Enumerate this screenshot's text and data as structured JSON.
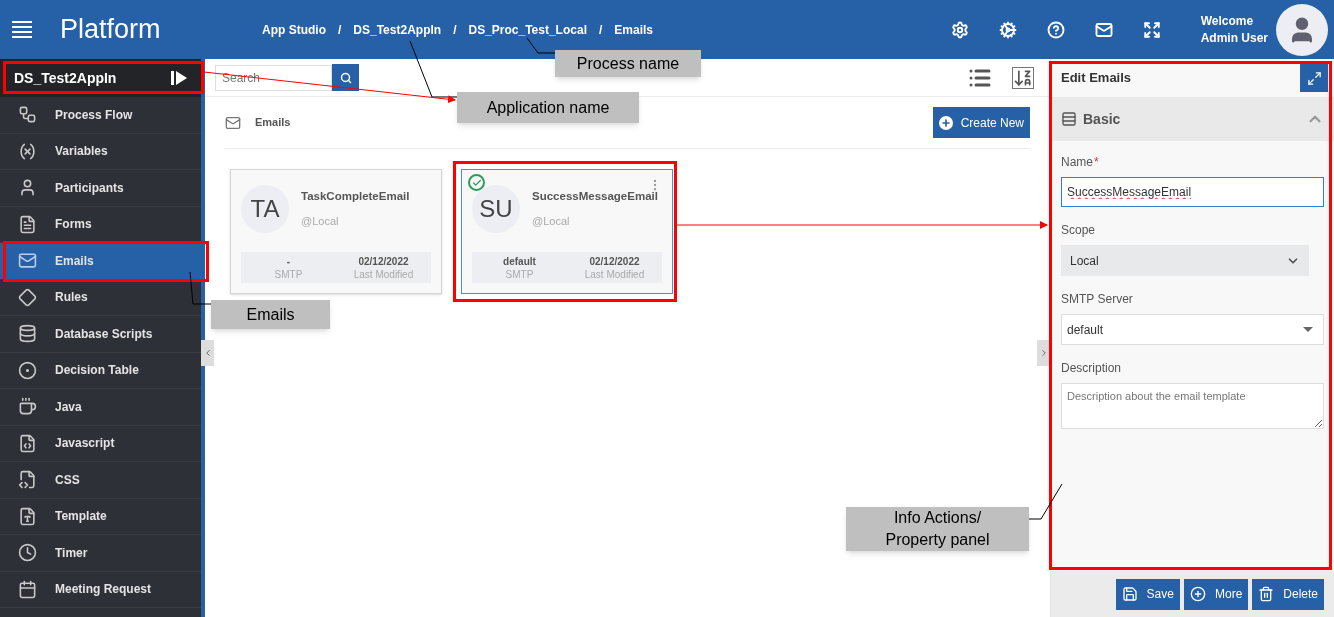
{
  "header": {
    "title": "Platform",
    "breadcrumbs": [
      {
        "label": "App Studio"
      },
      {
        "separator": "/",
        "label": "DS_Test2AppIn"
      },
      {
        "separator": "/",
        "label": "DS_Proc_Test_Local"
      },
      {
        "separator": "/",
        "label": "Emails"
      }
    ],
    "welcome": "Welcome",
    "user": "Admin User"
  },
  "sidebar": {
    "app_name": "DS_Test2AppIn",
    "items": [
      {
        "label": "Process Flow",
        "kind": "flow",
        "selected": false
      },
      {
        "label": "Variables",
        "kind": "variable",
        "selected": false
      },
      {
        "label": "Participants",
        "kind": "user",
        "selected": false
      },
      {
        "label": "Forms",
        "kind": "form",
        "selected": false
      },
      {
        "label": "Emails",
        "kind": "mail",
        "selected": true
      },
      {
        "label": "Rules",
        "kind": "rule",
        "selected": false
      },
      {
        "label": "Database Scripts",
        "kind": "database",
        "selected": false
      },
      {
        "label": "Decision Table",
        "kind": "table",
        "selected": false
      },
      {
        "label": "Java",
        "kind": "java",
        "selected": false
      },
      {
        "label": "Javascript",
        "kind": "js",
        "selected": false
      },
      {
        "label": "CSS",
        "kind": "css",
        "selected": false
      },
      {
        "label": "Template",
        "kind": "template",
        "selected": false
      },
      {
        "label": "Timer",
        "kind": "timer",
        "selected": false
      },
      {
        "label": "Meeting Request",
        "kind": "calendar",
        "selected": false
      }
    ]
  },
  "toolbar": {
    "search": {
      "placeholder": "Search"
    }
  },
  "section": {
    "title": "Emails",
    "create_button": "Create New"
  },
  "cards": [
    {
      "initials": "TA",
      "name": "TaskCompleteEmail",
      "scope": "@Local",
      "smtp": "-",
      "smtp_label": "SMTP",
      "date": "02/12/2022",
      "date_label": "Last Modified",
      "selected": false
    },
    {
      "initials": "SU",
      "name": "SuccessMessageEmail",
      "scope": "@Local",
      "smtp": "default",
      "smtp_label": "SMTP",
      "date": "02/12/2022",
      "date_label": "Last Modified",
      "selected": true
    }
  ],
  "panel": {
    "title": "Edit Emails",
    "section": {
      "title": "Basic",
      "expanded": true
    },
    "fields": [
      {
        "kind": "text",
        "label": "Name",
        "required": true,
        "required_mark": "*",
        "value": "SuccessMessageEmail"
      },
      {
        "kind": "select",
        "label": "Scope",
        "required": false,
        "value": "Local"
      },
      {
        "kind": "dropdown",
        "label": "SMTP Server",
        "required": false,
        "value": "default"
      },
      {
        "kind": "textarea",
        "label": "Description",
        "required": false,
        "placeholder": "Description about the email template"
      }
    ],
    "buttons": [
      {
        "label": "Save",
        "kind": "save"
      },
      {
        "label": "More",
        "kind": "more"
      },
      {
        "label": "Delete",
        "kind": "delete"
      }
    ]
  },
  "annotations": [
    {
      "kind": "process",
      "text": "Process name"
    },
    {
      "kind": "application",
      "text": "Application name"
    },
    {
      "kind": "emails",
      "text": "Emails"
    },
    {
      "kind": "panel",
      "text": "Info Actions/ Property panel"
    }
  ]
}
